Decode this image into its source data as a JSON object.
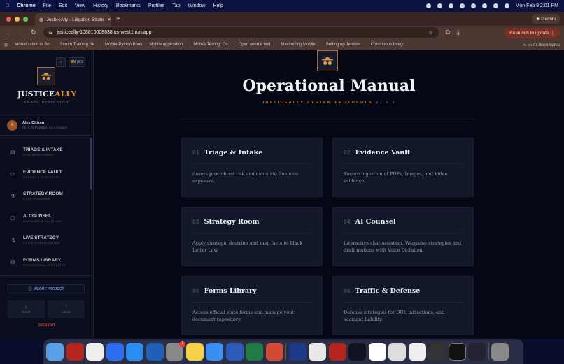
{
  "menubar": {
    "app": "Chrome",
    "items": [
      "File",
      "Edit",
      "View",
      "History",
      "Bookmarks",
      "Profiles",
      "Tab",
      "Window",
      "Help"
    ],
    "clock": "Mon Feb 9  2:01 PM"
  },
  "browser": {
    "tab_title": "JusticeAlly - Litigation Strate",
    "url": "justiceally-108816008638.us-west1.run.app",
    "gemini": "Gemini",
    "relaunch": "Relaunch to update",
    "bookmarks": [
      "Virtualization in So...",
      "Scrum Training Se...",
      "Mobile Python Book",
      "Mobile application...",
      "Mobile Testing: Co...",
      "Open source test...",
      "Maximizing Mobile...",
      "Setting up Jenkins...",
      "Continuous Integr..."
    ],
    "all_bookmarks": "All Bookmarks"
  },
  "sidebar": {
    "lang_en": "EN",
    "lang_es": "ES",
    "brand_a": "JUSTICE",
    "brand_b": "ALLY",
    "tagline": "LEGAL NAVIGATOR",
    "user": {
      "initial": "A",
      "name": "Alex Citizen",
      "role": "SELF-REPRESENTED LITIGANT"
    },
    "items": [
      {
        "label": "TRIAGE & INTAKE",
        "sub": "RISK ASSESSMENT",
        "icon": "document-icon"
      },
      {
        "label": "EVIDENCE VAULT",
        "sub": "DOCKET & DISCOVERY",
        "icon": "archive-icon"
      },
      {
        "label": "STRATEGY ROOM",
        "sub": "CASE PLANNING",
        "icon": "flask-icon"
      },
      {
        "label": "AI COUNSEL",
        "sub": "WARGAME & ASSISTANT",
        "icon": "chat-icon"
      },
      {
        "label": "LIVE STRATEGY",
        "sub": "VOICE CONSULTATION",
        "icon": "microphone-icon"
      },
      {
        "label": "FORMS LIBRARY",
        "sub": "PROCEDURAL TEMPLATES",
        "icon": "form-icon"
      }
    ],
    "about": "ABOUT PROJECT",
    "save": "SAVE",
    "load": "LOAD",
    "signout": "SIGN OUT"
  },
  "main": {
    "title": "Operational Manual",
    "subtitle": "JUSTICEALLY SYSTEM PROTOCOLS",
    "version": "V1.0.5",
    "cards": [
      {
        "num": "01",
        "title": "Triage & Intake",
        "desc": "Assess procedural risk and calculate financial exposure."
      },
      {
        "num": "02",
        "title": "Evidence Vault",
        "desc": "Secure ingestion of PDFs, Images, and Video evidence."
      },
      {
        "num": "03",
        "title": "Strategy Room",
        "desc": "Apply strategic doctrine and map facts to Black Letter Law."
      },
      {
        "num": "04",
        "title": "AI Counsel",
        "desc": "Interactive chat assistant. Wargame strategies and draft motions with Voice Dictation."
      },
      {
        "num": "05",
        "title": "Forms Library",
        "desc": "Access official state forms and manage your document repository."
      },
      {
        "num": "06",
        "title": "Traffic & Defense",
        "desc": "Defense strategies for DUI, infractions, and accident liability."
      }
    ]
  },
  "colors": {
    "accent": "#e0953a",
    "background": "#050814",
    "card": "#121829",
    "signout": "#c7433a"
  },
  "dock": {
    "badge": "1"
  }
}
